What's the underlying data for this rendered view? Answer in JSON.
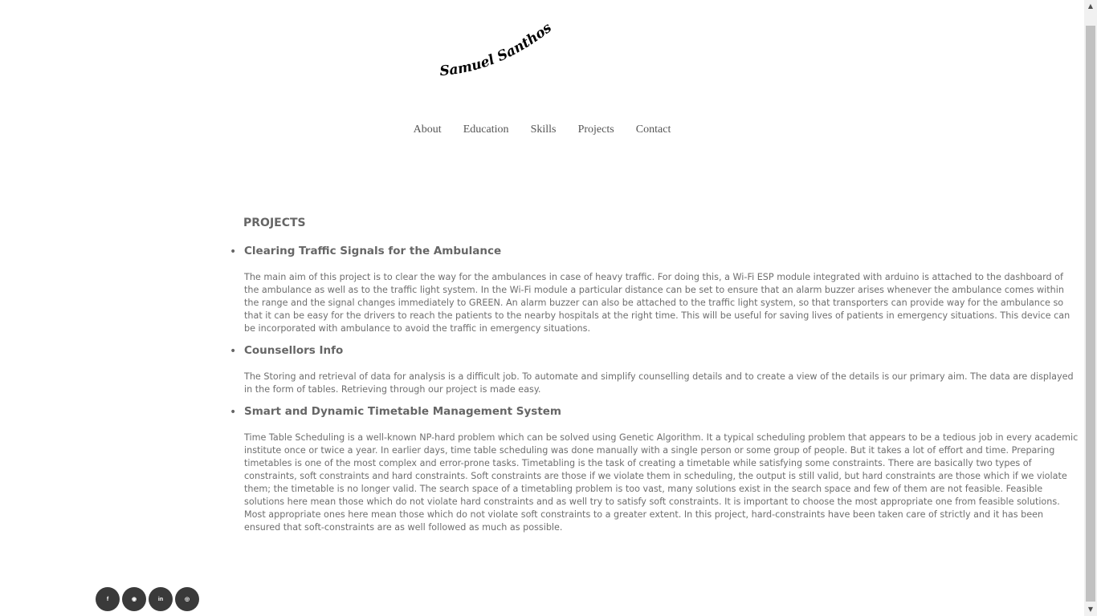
{
  "header": {
    "logo_text": "Samuel Santhosh"
  },
  "nav": {
    "items": [
      "About",
      "Education",
      "Skills",
      "Projects",
      "Contact"
    ]
  },
  "main": {
    "section_title": "PROJECTS",
    "projects": [
      {
        "title": "Clearing Traffic Signals for the Ambulance",
        "description": "The main aim of this project is to clear the way for the ambulances in case of heavy traffic. For doing this, a Wi-Fi ESP module integrated with arduino is attached to the dashboard of the ambulance as well as to the traffic light system. In the Wi-Fi module a particular distance can be set to ensure that an alarm buzzer arises whenever the ambulance comes within the range and the signal changes immediately to GREEN. An alarm buzzer can also be attached to the traffic light system, so that transporters can provide way for the ambulance so that it can be easy for the drivers to reach the patients to the nearby hospitals at the right time. This will be useful for saving lives of patients in emergency situations. This device can be incorporated with ambulance to avoid the traffic in emergency situations."
      },
      {
        "title": "Counsellors Info",
        "description": "The Storing and retrieval of data for analysis is a difficult job. To automate and simplify counselling details and to create a view of the details is our primary aim. The data are displayed in the form of tables. Retrieving through our project is made easy."
      },
      {
        "title": "Smart and Dynamic Timetable Management System",
        "description": "Time Table Scheduling is a well-known NP-hard problem which can be solved using Genetic Algorithm. It a typical scheduling problem that appears to be a tedious job in every academic institute once or twice a year. In earlier days, time table scheduling was done manually with a single person or some group of people. But it takes a lot of effort and time. Preparing timetables is one of the most complex and error-prone tasks. Timetabling is the task of creating a timetable while satisfying some constraints. There are basically two types of constraints, soft constraints and hard constraints. Soft constraints are those if we violate them in scheduling, the output is still valid, but hard constraints are those which if we violate them; the timetable is no longer valid. The search space of a timetabling problem is too vast, many solutions exist in the search space and few of them are not feasible. Feasible solutions here mean those which do not violate hard constraints and as well try to satisfy soft constraints. It is important to choose the most appropriate one from feasible solutions. Most appropriate ones here mean those which do not violate soft constraints to a greater extent. In this project, hard-constraints have been taken care of strictly and it has been ensured that soft-constraints are as well followed as much as possible."
      }
    ]
  },
  "social": {
    "buttons": [
      {
        "icon": "facebook-icon",
        "glyph": "f"
      },
      {
        "icon": "github-icon",
        "glyph": "◉"
      },
      {
        "icon": "linkedin-icon",
        "glyph": "in"
      },
      {
        "icon": "instagram-icon",
        "glyph": "◎"
      }
    ]
  },
  "colors": {
    "text": "#666666",
    "social_bg": "#3a3a3a",
    "scrollbar_track": "#f1f1f1",
    "scrollbar_thumb": "#c1c1c1"
  }
}
